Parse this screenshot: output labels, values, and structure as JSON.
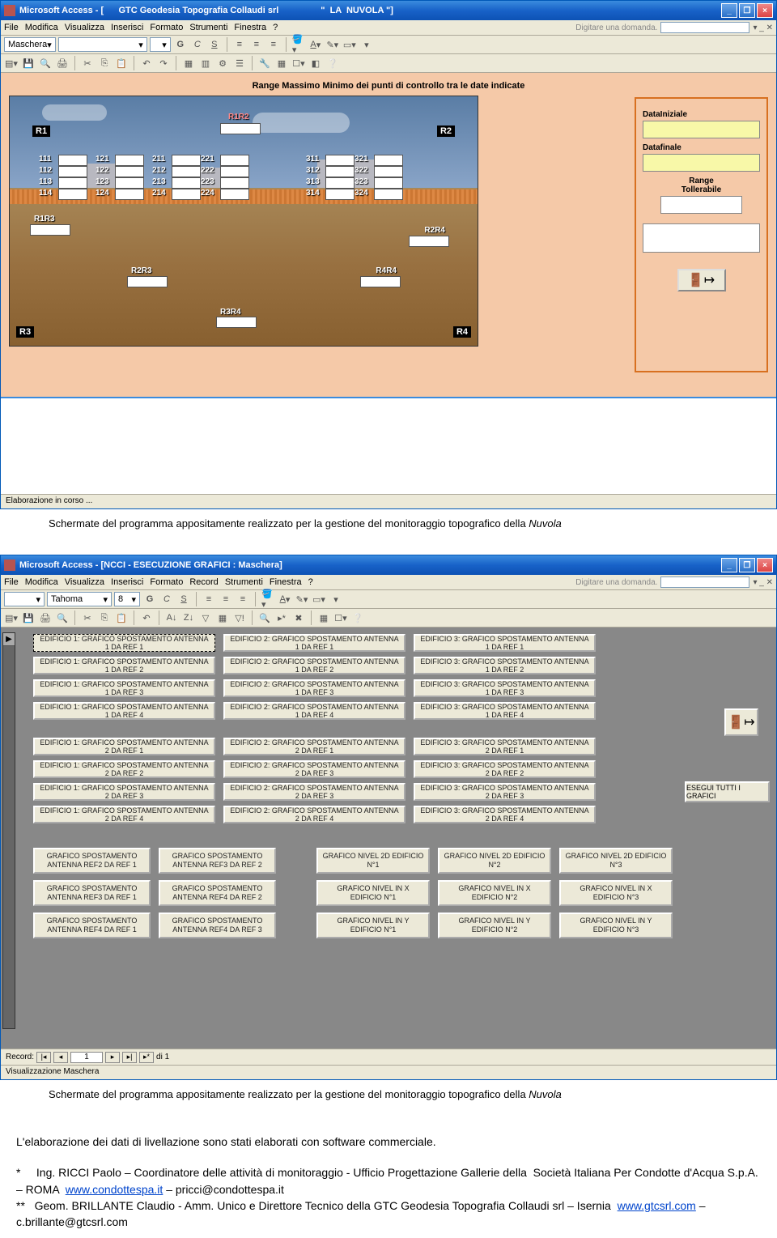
{
  "win1": {
    "title_app": "Microsoft Access - [",
    "title_company": "      GTC Geodesia Topografia Collaudi srl",
    "title_suffix": "                 \"  LA  NUVOLA \"]",
    "menu": [
      "File",
      "Modifica",
      "Visualizza",
      "Inserisci",
      "Formato",
      "Strumenti",
      "Finestra",
      "?"
    ],
    "searchlabel": "Digitare una domanda.",
    "toolbar_label": "Maschera",
    "form_title": "Range  Massimo  Minimo dei punti di controllo  tra le date indicate",
    "corners": {
      "r1": "R1",
      "r2": "R2",
      "r3": "R3",
      "r4": "R4"
    },
    "top_mid": "R1R2",
    "midlabels": [
      "R1R3",
      "R2R4",
      "R2R3",
      "R4R4",
      "R3R4"
    ],
    "grid_labels": [
      "111",
      "112",
      "113",
      "114",
      "121",
      "122",
      "123",
      "124",
      "211",
      "212",
      "213",
      "214",
      "221",
      "222",
      "223",
      "224",
      "311",
      "312",
      "313",
      "314",
      "321",
      "322",
      "323",
      "324"
    ],
    "side": {
      "l1": "DataIniziale",
      "l2": "Datafinale",
      "l3": "Range",
      "l3b": "Tollerabile"
    },
    "status": "Elaborazione in corso ...",
    "caption_prefix": "Schermate del programma appositamente realizzato per la gestione del monitoraggio topografico della ",
    "caption_em": "Nuvola"
  },
  "win2": {
    "title": "Microsoft Access - [NCCI - ESECUZIONE GRAFICI : Maschera]",
    "menu": [
      "File",
      "Modifica",
      "Visualizza",
      "Inserisci",
      "Formato",
      "Record",
      "Strumenti",
      "Finestra",
      "?"
    ],
    "font": "Tahoma",
    "fontsize": "8",
    "searchlabel": "Digitare una domanda.",
    "grid1": [
      "EDIFICIO 1: GRAFICO SPOSTAMENTO ANTENNA 1 DA REF 1",
      "EDIFICIO 2: GRAFICO SPOSTAMENTO ANTENNA 1 DA REF 1",
      "EDIFICIO 3: GRAFICO SPOSTAMENTO ANTENNA 1 DA REF 1",
      "EDIFICIO 1: GRAFICO SPOSTAMENTO ANTENNA 1 DA REF 2",
      "EDIFICIO 2: GRAFICO SPOSTAMENTO ANTENNA 1 DA REF 2",
      "EDIFICIO 3: GRAFICO SPOSTAMENTO ANTENNA 1 DA REF 2",
      "EDIFICIO 1: GRAFICO SPOSTAMENTO ANTENNA 1 DA REF 3",
      "EDIFICIO 2: GRAFICO SPOSTAMENTO ANTENNA 1 DA REF 3",
      "EDIFICIO 3: GRAFICO SPOSTAMENTO ANTENNA 1 DA REF 3",
      "EDIFICIO 1: GRAFICO SPOSTAMENTO ANTENNA 1 DA REF 4",
      "EDIFICIO 2: GRAFICO SPOSTAMENTO ANTENNA 1 DA REF 4",
      "EDIFICIO 3: GRAFICO SPOSTAMENTO ANTENNA 1 DA REF 4"
    ],
    "grid2": [
      "EDIFICIO 1: GRAFICO SPOSTAMENTO ANTENNA 2 DA REF 1",
      "EDIFICIO 2: GRAFICO SPOSTAMENTO ANTENNA 2 DA REF 1",
      "EDIFICIO 3: GRAFICO SPOSTAMENTO ANTENNA 2 DA REF 1",
      "EDIFICIO 1: GRAFICO SPOSTAMENTO ANTENNA 2 DA REF 2",
      "EDIFICIO 2: GRAFICO SPOSTAMENTO ANTENNA 2 DA REF 3",
      "EDIFICIO 3: GRAFICO SPOSTAMENTO ANTENNA 2 DA REF 2",
      "EDIFICIO 1: GRAFICO SPOSTAMENTO ANTENNA 2 DA REF 3",
      "EDIFICIO 2: GRAFICO SPOSTAMENTO ANTENNA 2 DA REF 3",
      "EDIFICIO 3: GRAFICO SPOSTAMENTO ANTENNA 2 DA REF 3",
      "EDIFICIO 1: GRAFICO SPOSTAMENTO ANTENNA 2 DA REF 4",
      "EDIFICIO 2: GRAFICO SPOSTAMENTO ANTENNA 2 DA REF 4",
      "EDIFICIO 3: GRAFICO SPOSTAMENTO ANTENNA 2 DA REF 4"
    ],
    "execall": "ESEGUI TUTTI I GRAFICI",
    "bottom": [
      [
        "GRAFICO SPOSTAMENTO ANTENNA REF2 DA REF 1",
        "GRAFICO SPOSTAMENTO ANTENNA REF3 DA REF 2",
        "",
        "GRAFICO NIVEL 2D EDIFICIO N°1",
        "GRAFICO NIVEL 2D EDIFICIO N°2",
        "GRAFICO NIVEL 2D EDIFICIO N°3"
      ],
      [
        "GRAFICO SPOSTAMENTO ANTENNA REF3 DA REF 1",
        "GRAFICO SPOSTAMENTO ANTENNA REF4 DA REF 2",
        "",
        "GRAFICO NIVEL IN X EDIFICIO N°1",
        "GRAFICO NIVEL IN X EDIFICIO N°2",
        "GRAFICO NIVEL IN X EDIFICIO N°3"
      ],
      [
        "GRAFICO SPOSTAMENTO ANTENNA REF4 DA REF 1",
        "GRAFICO SPOSTAMENTO ANTENNA REF4 DA REF 3",
        "",
        "GRAFICO NIVEL IN Y EDIFICIO N°1",
        "GRAFICO NIVEL IN Y EDIFICIO N°2",
        "GRAFICO NIVEL IN Y EDIFICIO N°3"
      ]
    ],
    "rec_label": "Record:",
    "rec_current": "1",
    "rec_of": "di 1",
    "status": "Visualizzazione Maschera",
    "caption_prefix": "Schermate del programma appositamente realizzato per la gestione del monitoraggio topografico della ",
    "caption_em": "Nuvola"
  },
  "text": {
    "p1": "L'elaborazione dei dati di livellazione sono stati elaborati con software commerciale.",
    "a1_star": "*",
    "a1_plain": "     Ing. RICCI Paolo – Coordinatore delle attività di monitoraggio - Ufficio Progettazione Gallerie della  Società Italiana Per Condotte d'Acqua S.p.A. – ROMA  ",
    "a1_link1": "www.condottespa.it",
    "a1_after1": " – pricci@condottespa.it",
    "a2_star": "**",
    "a2_plain": "   Geom. BRILLANTE Claudio - Amm. Unico e Direttore Tecnico della GTC Geodesia Topografia Collaudi srl – Isernia  ",
    "a2_link1": "www.gtcsrl.com",
    "a2_after1": " – c.brillante@gtcsrl.com"
  }
}
